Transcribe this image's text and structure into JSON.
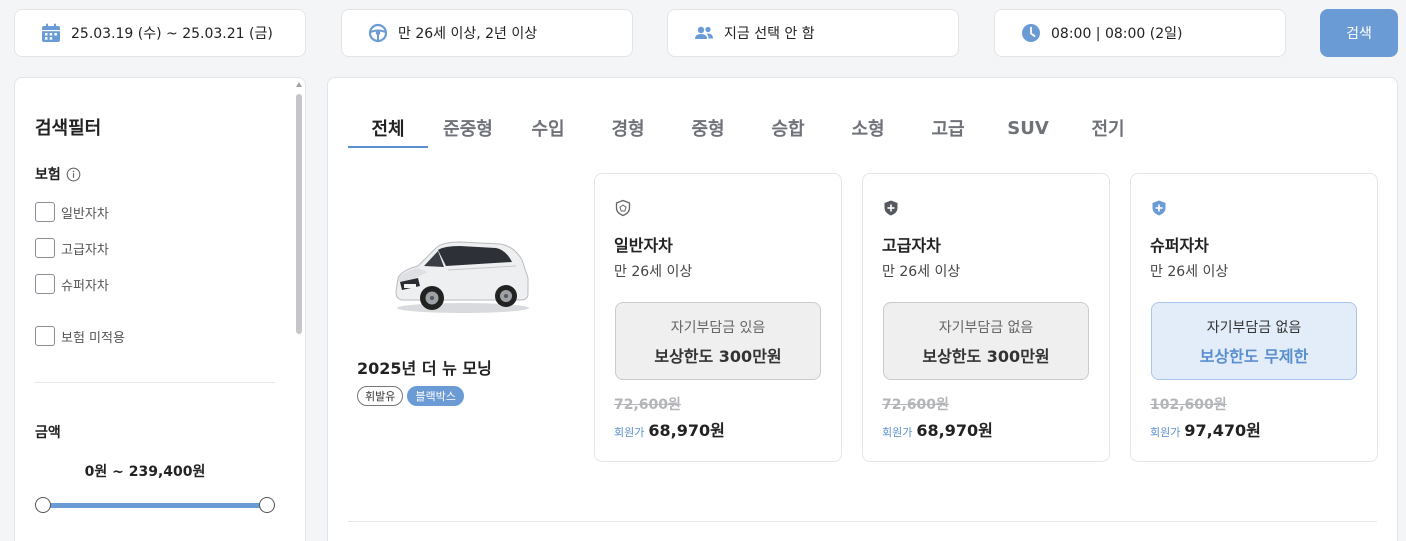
{
  "search_bar": {
    "date_range": "25.03.19 (수) ~ 25.03.21 (금)",
    "driver_condition": "만 26세 이상, 2년 이상",
    "people": "지금 선택 안 함",
    "time": "08:00 | 08:00 (2일)",
    "search_label": "검색",
    "icons": [
      "calendar-icon",
      "steering-wheel-icon",
      "people-icon",
      "clock-icon"
    ],
    "icon_color": "#6b9bd4"
  },
  "sidebar": {
    "title": "검색필터",
    "insurance": {
      "label": "보험",
      "options": [
        "일반자차",
        "고급자차",
        "슈퍼자차"
      ],
      "none_option": "보험 미적용"
    },
    "price": {
      "label": "금액",
      "range": "0원 ~ 239,400원"
    }
  },
  "tabs": [
    "전체",
    "준중형",
    "수입",
    "경형",
    "중형",
    "승합",
    "소형",
    "고급",
    "SUV",
    "전기"
  ],
  "active_tab": "전체",
  "car": {
    "name": "2025년 더 뉴 모닝",
    "tags": [
      "휘발유",
      "블랙박스"
    ]
  },
  "insurance_cards": [
    {
      "name": "일반자차",
      "age": "만 26세 이상",
      "deductible": "자기부담금 있음",
      "coverage": "보상한도 300만원",
      "original_price": "72,600원",
      "member_label": "회원가",
      "member_price": "68,970원",
      "icon": "shield-outline-icon",
      "highlighted": false
    },
    {
      "name": "고급자차",
      "age": "만 26세 이상",
      "deductible": "자기부담금 없음",
      "coverage": "보상한도 300만원",
      "original_price": "72,600원",
      "member_label": "회원가",
      "member_price": "68,970원",
      "icon": "shield-plus-dark-icon",
      "highlighted": false
    },
    {
      "name": "슈퍼자차",
      "age": "만 26세 이상",
      "deductible": "자기부담금 없음",
      "coverage": "보상한도 무제한",
      "original_price": "102,600원",
      "member_label": "회원가",
      "member_price": "97,470원",
      "icon": "shield-plus-blue-icon",
      "highlighted": true
    }
  ],
  "colors": {
    "accent": "#6b9bd4",
    "accent_text": "#5a8fcf",
    "highlight_bg": "#e3edf9"
  }
}
